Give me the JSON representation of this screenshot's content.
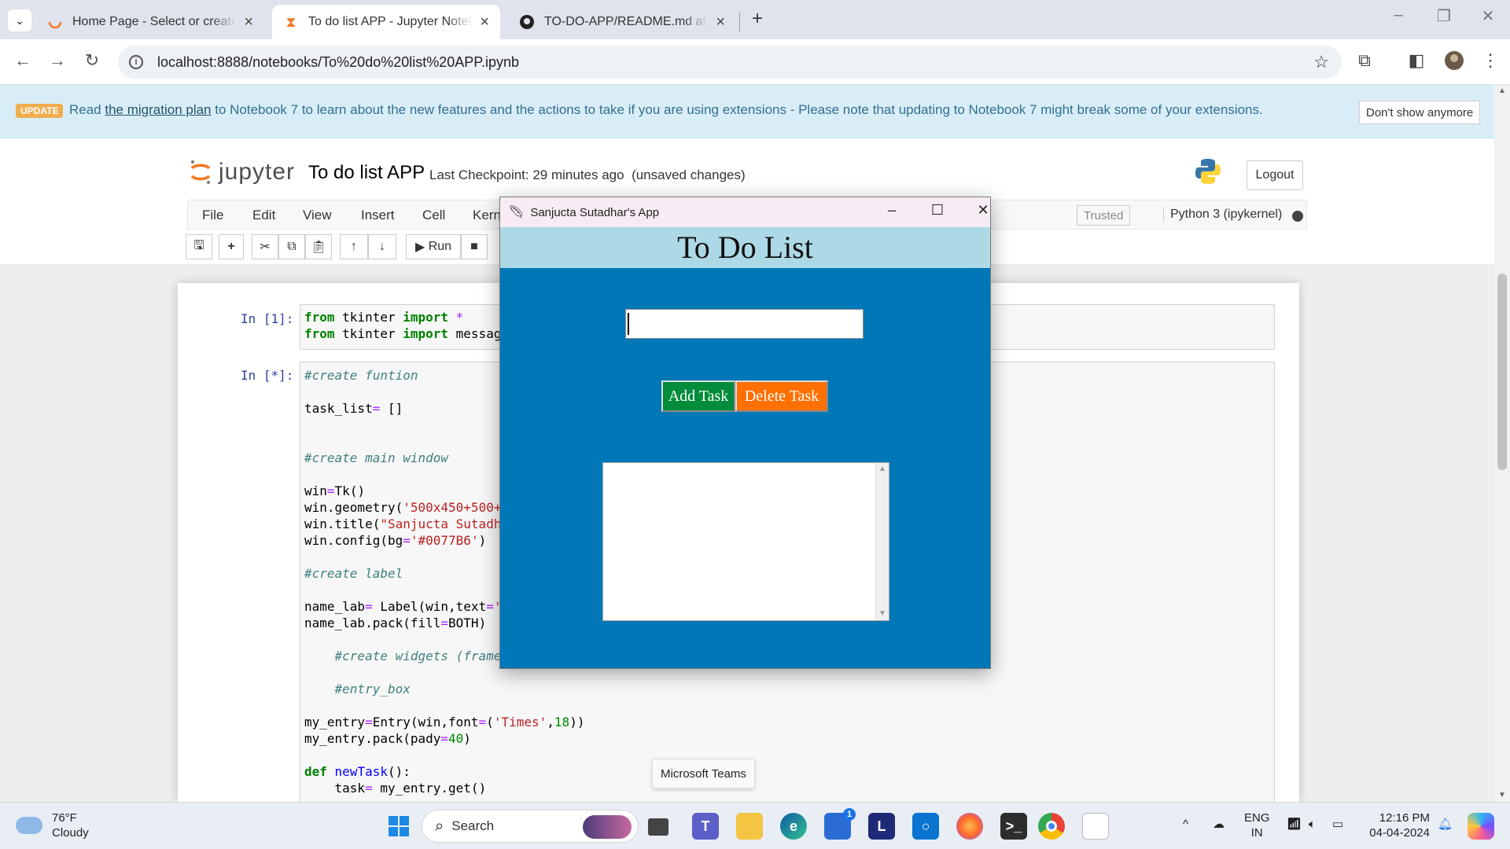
{
  "browser": {
    "tabs": [
      {
        "title": "Home Page - Select or create a",
        "active": false
      },
      {
        "title": "To do list APP - Jupyter Notebo",
        "active": true
      },
      {
        "title": "TO-DO-APP/README.md at ma",
        "active": false
      }
    ],
    "url": "localhost:8888/notebooks/To%20do%20list%20APP.ipynb"
  },
  "banner": {
    "badge": "UPDATE",
    "pre": "Read ",
    "link": "the migration plan",
    "post": " to Notebook 7 to learn about the new features and the actions to take if you are using extensions - Please note that updating to Notebook 7 might break some of your extensions.",
    "dismiss": "Don't show anymore"
  },
  "jupyter": {
    "logo_text": "jupyter",
    "notebook_name": "To do list APP",
    "checkpoint": "Last Checkpoint: 29 minutes ago",
    "unsaved": "(unsaved changes)",
    "logout": "Logout",
    "menus": [
      "File",
      "Edit",
      "View",
      "Insert",
      "Cell",
      "Kern"
    ],
    "trusted": "Trusted",
    "kernel": "Python 3 (ipykernel)",
    "run_label": "Run"
  },
  "cells": [
    {
      "prompt": "In [1]:"
    },
    {
      "prompt": "In [*]:"
    }
  ],
  "tk_app": {
    "title": "Sanjucta Sutadhar's App",
    "heading": "To Do List",
    "add_button": "Add Task",
    "delete_button": "Delete Task",
    "entry_value": "",
    "colors": {
      "bg": "#0077B6",
      "label_bg": "#add8e6",
      "add": "#008c3a",
      "delete": "#ff7000"
    }
  },
  "tooltip": "Microsoft Teams",
  "taskbar": {
    "weather_temp": "76°F",
    "weather_desc": "Cloudy",
    "search_placeholder": "Search",
    "lang_top": "ENG",
    "lang_bottom": "IN",
    "time": "12:16 PM",
    "date": "04-04-2024",
    "store_badge": "1"
  }
}
